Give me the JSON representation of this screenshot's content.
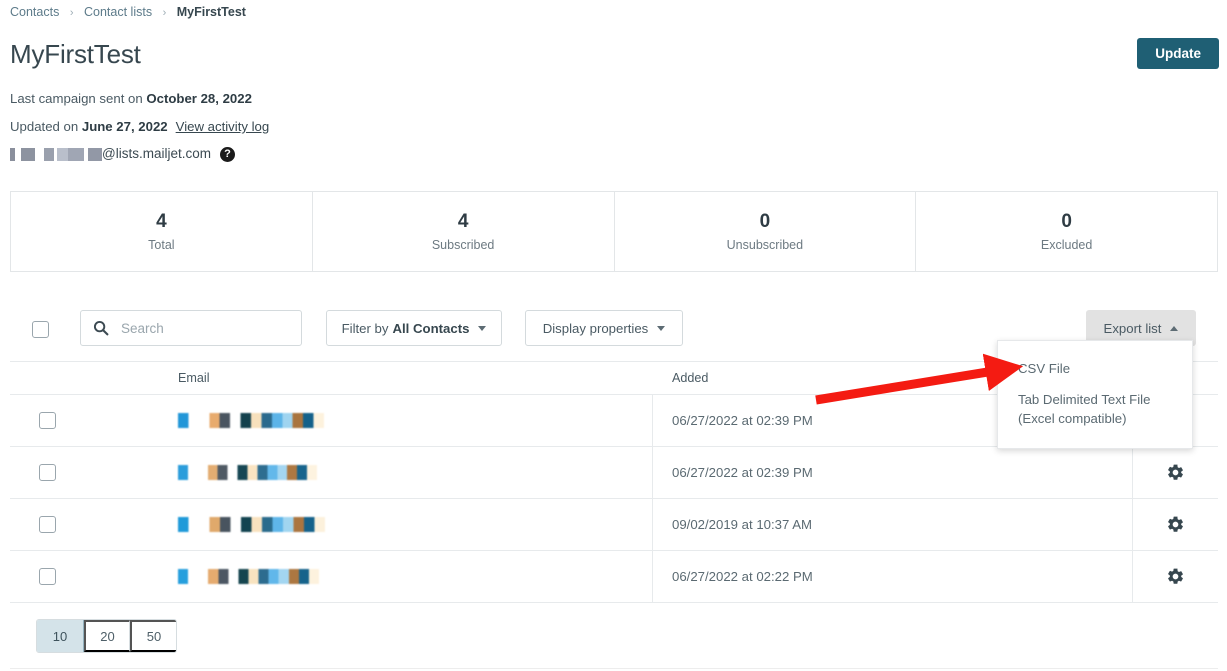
{
  "breadcrumb": {
    "items": [
      {
        "label": "Contacts",
        "current": false
      },
      {
        "label": "Contact lists",
        "current": false
      },
      {
        "label": "MyFirstTest",
        "current": true
      }
    ],
    "separator": "›"
  },
  "header": {
    "title": "MyFirstTest",
    "update_label": "Update"
  },
  "meta": {
    "last_campaign_prefix": "Last campaign sent on ",
    "last_campaign_date": "October 28, 2022",
    "updated_prefix": "Updated on ",
    "updated_date": "June 27, 2022",
    "activity_log_label": "View activity log",
    "list_address_redacted": "██████",
    "list_address_domain": "@lists.mailjet.com",
    "help_glyph": "?"
  },
  "stats": [
    {
      "value": "4",
      "label": "Total"
    },
    {
      "value": "4",
      "label": "Subscribed"
    },
    {
      "value": "0",
      "label": "Unsubscribed"
    },
    {
      "value": "0",
      "label": "Excluded"
    }
  ],
  "toolbar": {
    "search_placeholder": "Search",
    "search_value": "",
    "filter_prefix": "Filter by ",
    "filter_value": "All Contacts",
    "display_properties_label": "Display properties",
    "export_label": "Export list"
  },
  "export_menu": {
    "items": [
      {
        "label": "CSV File"
      },
      {
        "label": "Tab Delimited Text File (Excel compatible)"
      }
    ]
  },
  "table": {
    "columns": [
      "Email",
      "Added"
    ],
    "rows": [
      {
        "email": "████████",
        "added": "06/27/2022 at 02:39 PM",
        "gear": "gear-icon"
      },
      {
        "email": "████████",
        "added": "06/27/2022 at 02:39 PM",
        "gear": "gear-icon"
      },
      {
        "email": "████████",
        "added": "09/02/2019 at 10:37 AM",
        "gear": "gear-icon"
      },
      {
        "email": "████████",
        "added": "06/27/2022 at 02:22 PM",
        "gear": "gear-icon"
      }
    ]
  },
  "pagination": {
    "options": [
      "10",
      "20",
      "50"
    ],
    "selected": "10"
  },
  "colors": {
    "accent_button": "#1f5f74",
    "page_active": "#d4e3e9",
    "annotation_arrow": "#f41b12",
    "text_primary": "#37474f",
    "text_muted": "#6d7a82",
    "border": "#e7eaec"
  }
}
